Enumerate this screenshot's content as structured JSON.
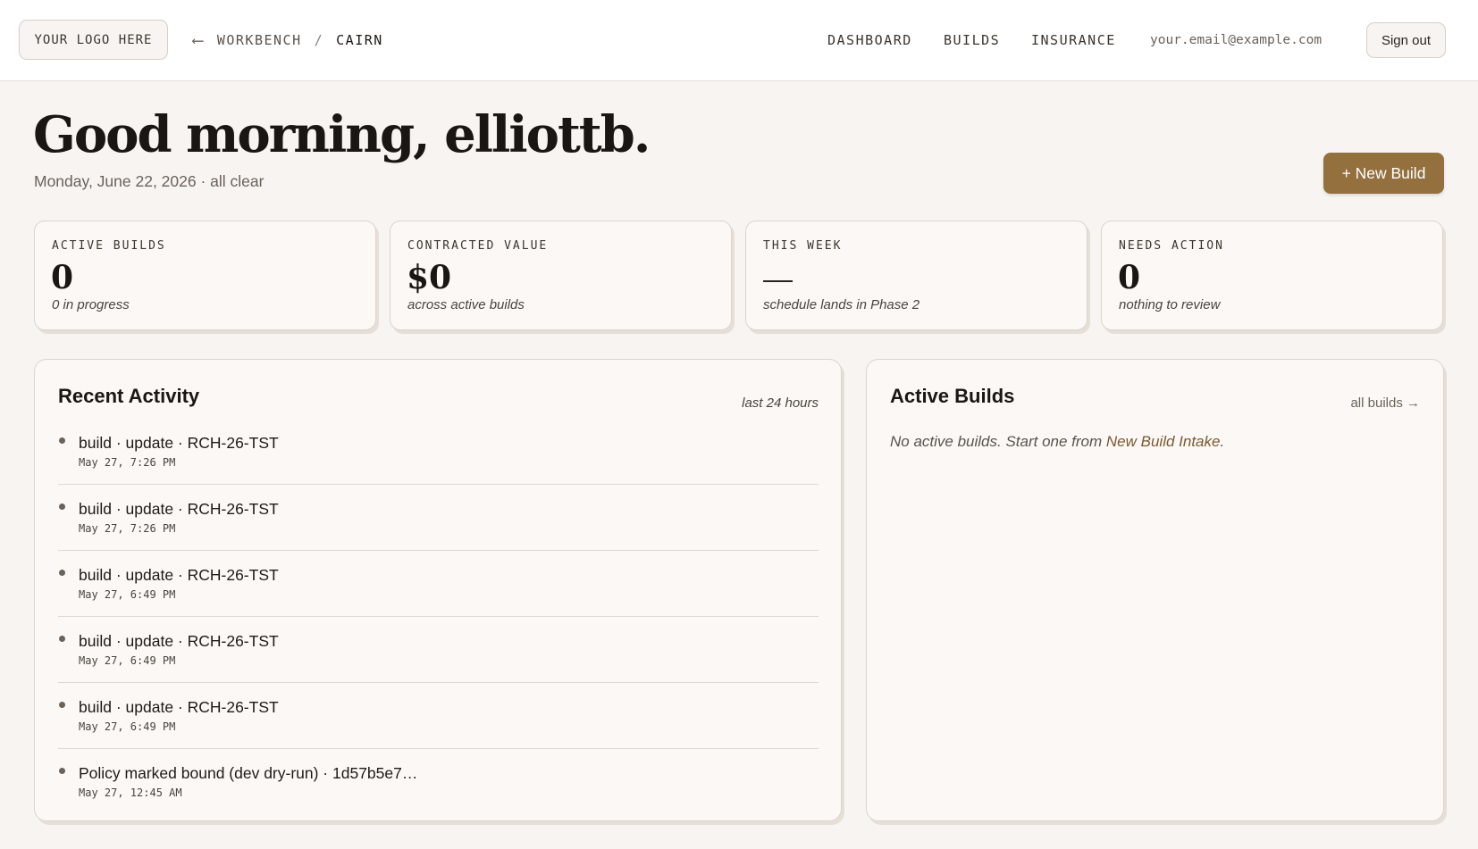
{
  "header": {
    "logo": "YOUR LOGO HERE",
    "back_arrow": "⟵",
    "breadcrumb": [
      "WORKBENCH",
      "CAIRN"
    ],
    "breadcrumb_sep": "/",
    "nav": [
      "DASHBOARD",
      "BUILDS",
      "INSURANCE"
    ],
    "email": "your.email@example.com",
    "sign_out": "Sign out"
  },
  "greeting": {
    "title": "Good morning, elliottb.",
    "subtitle": "Monday, June 22, 2026 · all clear",
    "new_build": "+ New Build"
  },
  "stats": [
    {
      "label": "ACTIVE BUILDS",
      "value": "0",
      "note": "0 in progress"
    },
    {
      "label": "CONTRACTED VALUE",
      "value": "$0",
      "note": "across active builds"
    },
    {
      "label": "THIS WEEK",
      "value": "—",
      "note": "schedule lands in Phase 2"
    },
    {
      "label": "NEEDS ACTION",
      "value": "0",
      "note": "nothing to review"
    }
  ],
  "recent_activity": {
    "title": "Recent Activity",
    "meta": "last 24 hours",
    "items": [
      {
        "title": "build · update · RCH-26-TST",
        "time": "May 27, 7:26 PM"
      },
      {
        "title": "build · update · RCH-26-TST",
        "time": "May 27, 7:26 PM"
      },
      {
        "title": "build · update · RCH-26-TST",
        "time": "May 27, 6:49 PM"
      },
      {
        "title": "build · update · RCH-26-TST",
        "time": "May 27, 6:49 PM"
      },
      {
        "title": "build · update · RCH-26-TST",
        "time": "May 27, 6:49 PM"
      },
      {
        "title": "Policy marked bound (dev dry-run) · 1d57b5e7…",
        "time": "May 27, 12:45 AM"
      }
    ]
  },
  "active_builds": {
    "title": "Active Builds",
    "link": "all builds →",
    "empty_prefix": "No active builds. Start one from ",
    "empty_link": "New Build Intake",
    "empty_suffix": "."
  }
}
